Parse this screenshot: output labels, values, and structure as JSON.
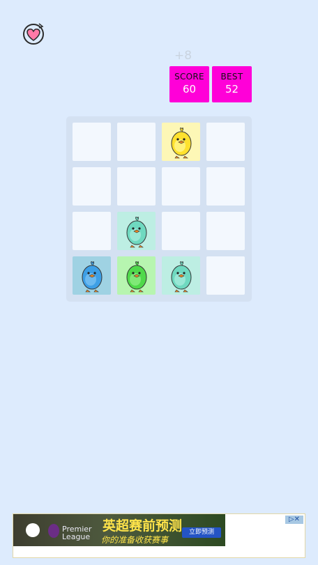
{
  "app": {
    "logo_icon": "heart-arrow-icon"
  },
  "header": {
    "score_delta": "+8",
    "score": {
      "label": "SCORE",
      "value": "60"
    },
    "best": {
      "label": "BEST",
      "value": "52"
    }
  },
  "board": {
    "rows": 4,
    "cols": 4,
    "tiles": [
      [
        "empty",
        "empty",
        "yellow-chick",
        "empty"
      ],
      [
        "empty",
        "empty",
        "empty",
        "empty"
      ],
      [
        "empty",
        "teal-chick",
        "empty",
        "empty"
      ],
      [
        "blue-chick",
        "green-chick",
        "teal-chick",
        "empty"
      ]
    ]
  },
  "ad": {
    "headline": "英超赛前预测",
    "subline": "你的准备收获赛事",
    "league": "Premier League",
    "cta": "立即预测",
    "badge_icons": [
      "ad-choices-icon",
      "close-icon"
    ]
  },
  "colors": {
    "background": "#ddebfd",
    "score_box": "#ff00d8",
    "board": "#d4e1f2",
    "empty_cell": "#f3f8fe",
    "yellow_tile": "#fdf7b6",
    "teal_tile": "#bdeee3",
    "blue_tile": "#9fd2e3",
    "green_tile": "#b7f5b0"
  }
}
